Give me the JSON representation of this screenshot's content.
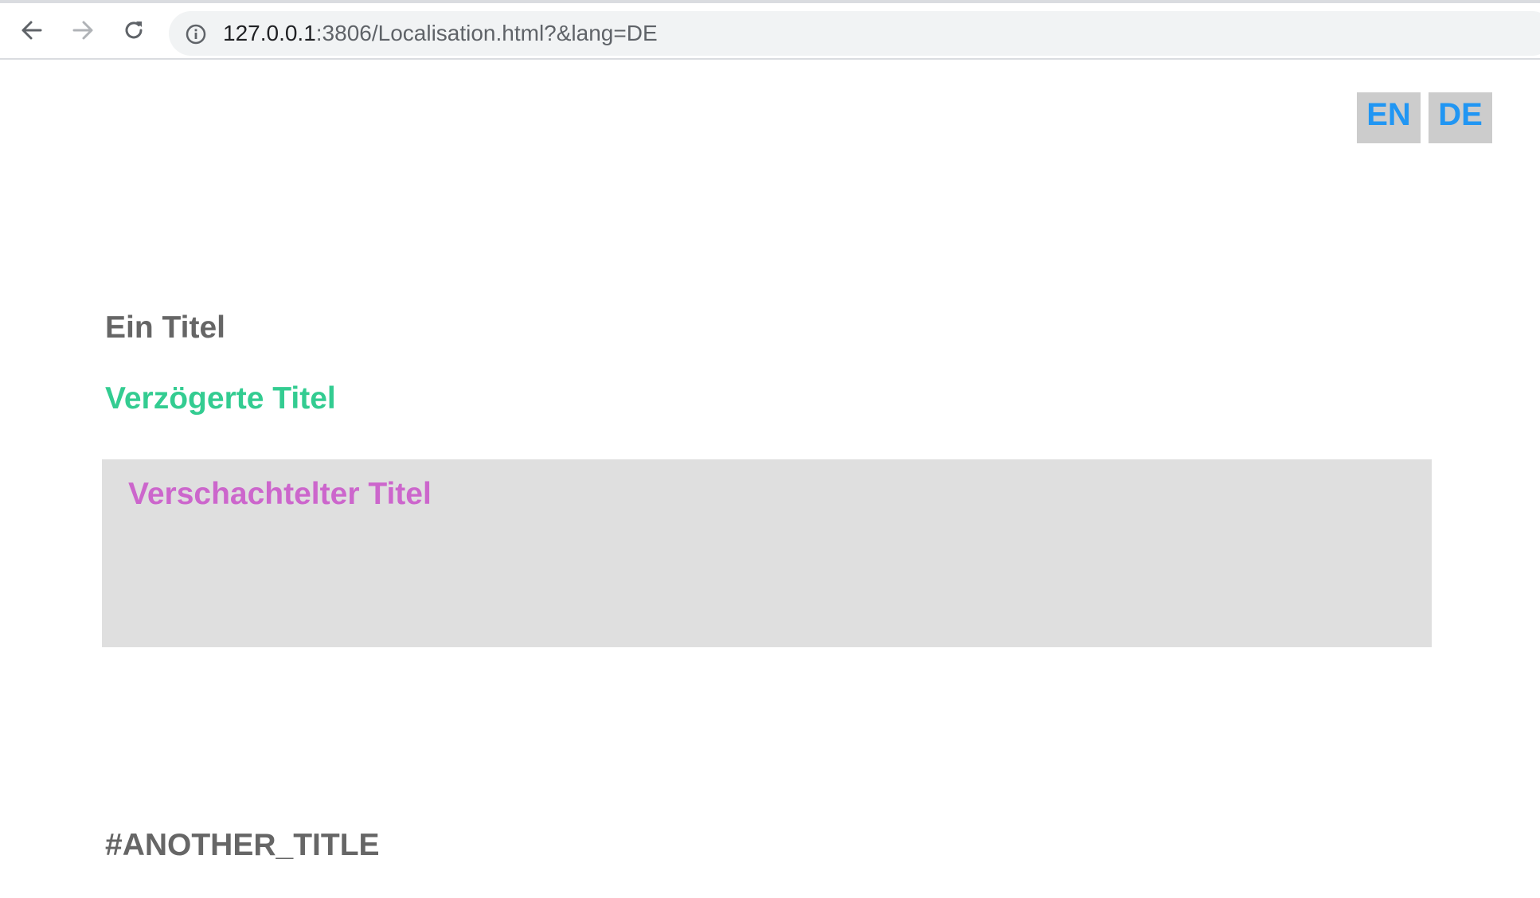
{
  "browser": {
    "url_host": "127.0.0.1",
    "url_rest": ":3806/Localisation.html?&lang=DE",
    "icons": {
      "back": "arrow-left-icon",
      "forward": "arrow-right-icon",
      "reload": "reload-icon",
      "site_info": "info-circle-icon"
    }
  },
  "language_switcher": {
    "en_label": "EN",
    "de_label": "DE",
    "active": "DE"
  },
  "content": {
    "title": "Ein Titel",
    "delayed_title": "Verzögerte Titel",
    "nested_title": "Verschachtelter Titel",
    "another_title": "#ANOTHER_TITLE"
  },
  "colors": {
    "lang_button_text": "#2196f3",
    "lang_button_bg": "#cccccc",
    "title": "#666666",
    "delayed_title": "#33cc91",
    "nested_title": "#cc66cc",
    "nested_box_bg": "#dfdfdf"
  }
}
